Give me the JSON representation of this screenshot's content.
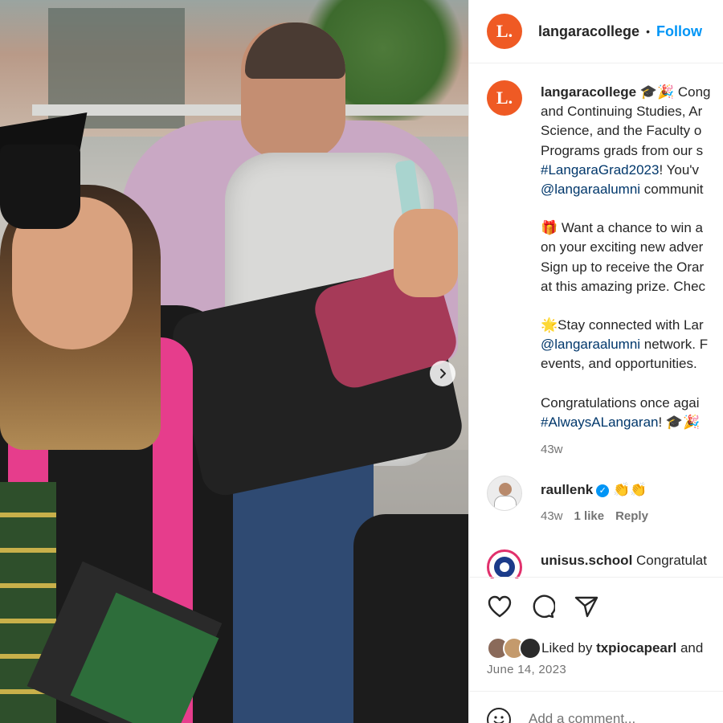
{
  "header": {
    "logo_letter": "L.",
    "username": "langaracollege",
    "separator": "•",
    "follow_label": "Follow"
  },
  "caption": {
    "username": "langaracollege",
    "line1_text": " 🎓🎉 Cong",
    "line2": "and Continuing Studies, Ar",
    "line3": "Science, and the Faculty o",
    "line4": "Programs grads from our s",
    "line5_tag": "#LangaraGrad2023",
    "line5_rest": "! You'v",
    "line6_mention": "@langaraalumni",
    "line6_rest": " communit",
    "line7": "🎁 Want a chance to win a",
    "line8": "on your exciting new adver",
    "line9": "Sign up to receive the Orar",
    "line10": "at this amazing prize. Chec",
    "line11": "🌟Stay connected with Lar",
    "line12_mention": "@langaraalumni",
    "line12_rest": " network. F",
    "line13": "events, and opportunities.",
    "line14": "Congratulations once agai",
    "line15_tag": "#AlwaysALangaran",
    "line15_rest": "! 🎓🎉",
    "time": "43w"
  },
  "comments": [
    {
      "username": "raullenk",
      "verified_glyph": "✓",
      "text": "👏👏",
      "time": "43w",
      "likes": "1 like",
      "reply": "Reply"
    },
    {
      "username": "unisus.school",
      "text": "Congratulat"
    }
  ],
  "actions": {
    "liked_by_prefix": "Liked by",
    "liked_by_user": "txpiocapearl",
    "liked_by_suffix": "and",
    "date": "June 14, 2023"
  },
  "add_comment": {
    "placeholder": "Add a comment..."
  },
  "colors": {
    "brand_orange": "#ef5a24",
    "follow_blue": "#0095f6",
    "link_blue": "#00376b"
  }
}
